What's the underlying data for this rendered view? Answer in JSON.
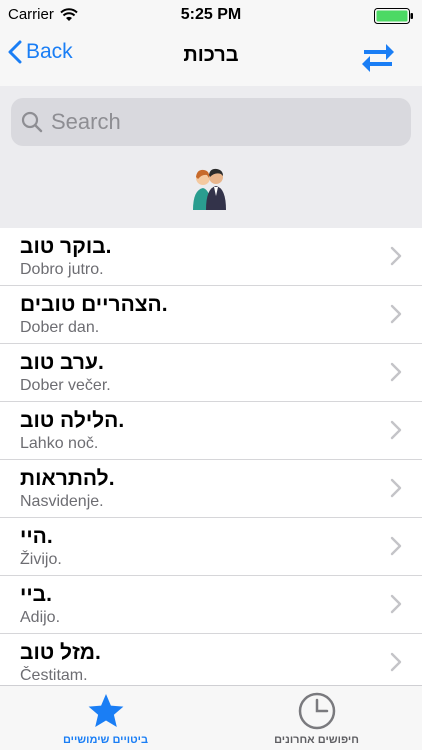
{
  "status_bar": {
    "carrier": "Carrier",
    "time": "5:25 PM"
  },
  "nav": {
    "back_label": "Back",
    "title": "ברכות"
  },
  "search": {
    "placeholder": "Search"
  },
  "phrases": [
    {
      "hebrew": "בוקר טוב.",
      "slovenian": "Dobro jutro."
    },
    {
      "hebrew": "הצהריים טובים.",
      "slovenian": "Dober dan."
    },
    {
      "hebrew": "ערב טוב.",
      "slovenian": "Dober večer."
    },
    {
      "hebrew": "הלילה טוב.",
      "slovenian": "Lahko noč."
    },
    {
      "hebrew": "להתראות.",
      "slovenian": "Nasvidenje."
    },
    {
      "hebrew": "היי.",
      "slovenian": "Živijo."
    },
    {
      "hebrew": "ביי.",
      "slovenian": "Adijo."
    },
    {
      "hebrew": "מזל טוב.",
      "slovenian": "Čestitam."
    }
  ],
  "tabs": [
    {
      "label": "ביטויים שימושיים",
      "icon": "star-icon",
      "active": true
    },
    {
      "label": "חיפושים אחרונים",
      "icon": "clock-icon",
      "active": false
    }
  ],
  "colors": {
    "accent": "#1a7ef5",
    "battery": "#4cd964"
  }
}
